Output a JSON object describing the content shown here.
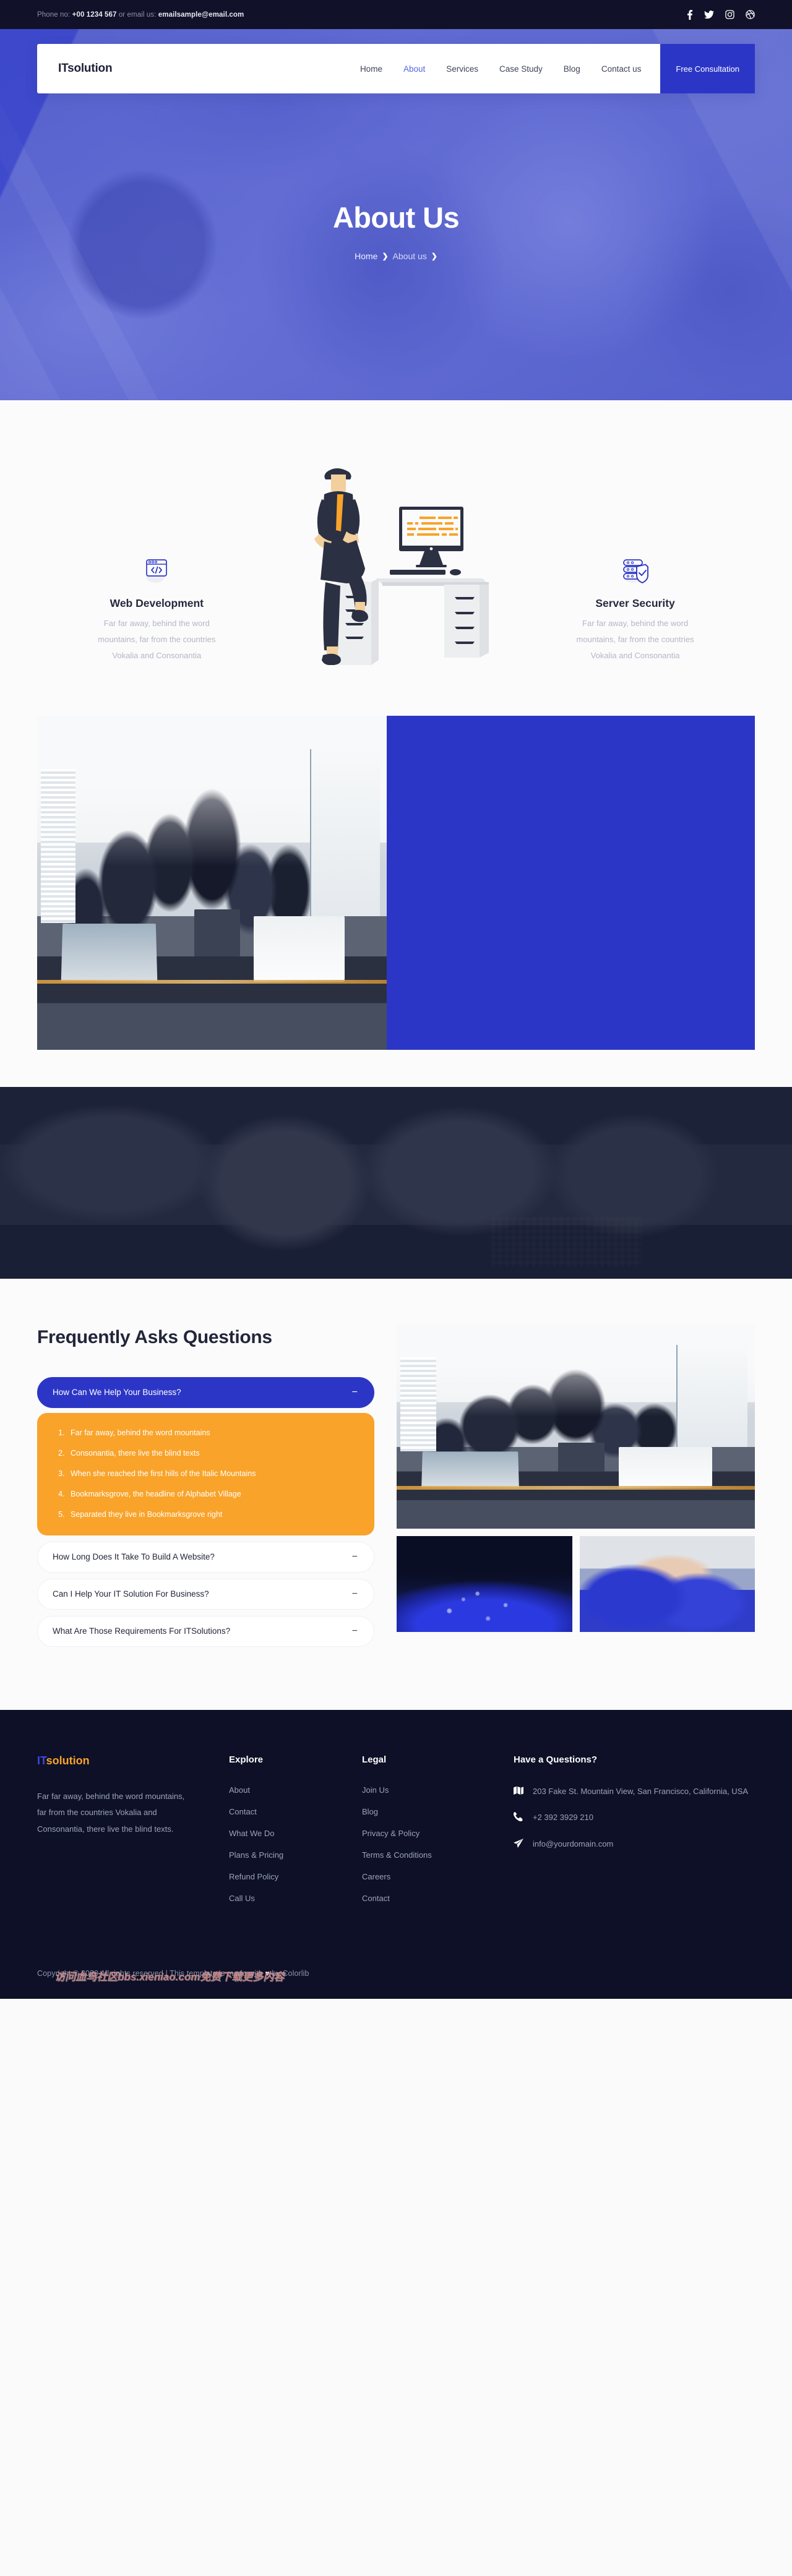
{
  "topbar": {
    "phone_label": "Phone no:",
    "phone": "+00 1234 567",
    "or_email_label": "or email us:",
    "email": "emailsample@email.com",
    "socials": [
      "facebook-icon",
      "twitter-icon",
      "instagram-icon",
      "dribbble-icon"
    ]
  },
  "nav": {
    "brand_it": "IT",
    "brand_rest": "solution",
    "links": [
      {
        "label": "Home",
        "active": false
      },
      {
        "label": "About",
        "active": true
      },
      {
        "label": "Services",
        "active": false
      },
      {
        "label": "Case Study",
        "active": false
      },
      {
        "label": "Blog",
        "active": false
      },
      {
        "label": "Contact us",
        "active": false
      }
    ],
    "cta_label": "Free Consultation"
  },
  "hero": {
    "title": "About Us",
    "breadcrumb": [
      "Home",
      "About us"
    ]
  },
  "services": [
    {
      "icon": "code-window-icon",
      "title": "Web Development",
      "desc": "Far far away, behind the word mountains, far from the countries Vokalia and Consonantia"
    },
    {
      "icon": "developer-illustration",
      "title": "",
      "desc": ""
    },
    {
      "icon": "server-shield-icon",
      "title": "Server Security",
      "desc": "Far far away, behind the word mountains, far from the countries Vokalia and Consonantia"
    }
  ],
  "faq": {
    "heading": "Frequently Asks Questions",
    "items": [
      {
        "question": "How Can We Help Your Business?",
        "open": true,
        "sign": "−",
        "answers": [
          "Far far away, behind the word mountains",
          "Consonantia, there live the blind texts",
          "When she reached the first hills of the Italic Mountains",
          "Bookmarksgrove, the headline of Alphabet Village",
          "Separated they live in Bookmarksgrove right"
        ]
      },
      {
        "question": "How Long Does It Take To Build A Website?",
        "open": false,
        "sign": "−",
        "answers": []
      },
      {
        "question": "Can I Help Your IT Solution For Business?",
        "open": false,
        "sign": "−",
        "answers": []
      },
      {
        "question": "What Are Those Requirements For ITSolutions?",
        "open": false,
        "sign": "−",
        "answers": []
      }
    ]
  },
  "footer": {
    "logo_it": "IT",
    "logo_rest": "solution",
    "about": "Far far away, behind the word mountains, far from the countries Vokalia and Consonantia, there live the blind texts.",
    "col_explore": {
      "heading": "Explore",
      "links": [
        "About",
        "Contact",
        "What We Do",
        "Plans & Pricing",
        "Refund Policy",
        "Call Us"
      ]
    },
    "col_legal": {
      "heading": "Legal",
      "links": [
        "Join Us",
        "Blog",
        "Privacy & Policy",
        "Terms & Conditions",
        "Careers",
        "Contact"
      ]
    },
    "col_contact": {
      "heading": "Have a Questions?",
      "address": "203 Fake St. Mountain View, San Francisco, California, USA",
      "phone": "+2 392 3929 210",
      "email": "info@yourdomain.com",
      "icons": [
        "map-icon",
        "phone-icon",
        "paper-plane-icon"
      ]
    },
    "copyright": "Copyright © 2020 All rights reserved | This template is made with",
    "copyright_tail": "by Colorlib",
    "heart": "♥",
    "watermark": "访问血鸟社区bbs.xieniao.com免费下载更多内容"
  },
  "colors": {
    "brand_blue": "#2c36c6",
    "hero_purple": "#5f6bd8",
    "accent_orange": "#f9a32a",
    "dark": "#0d1026"
  }
}
